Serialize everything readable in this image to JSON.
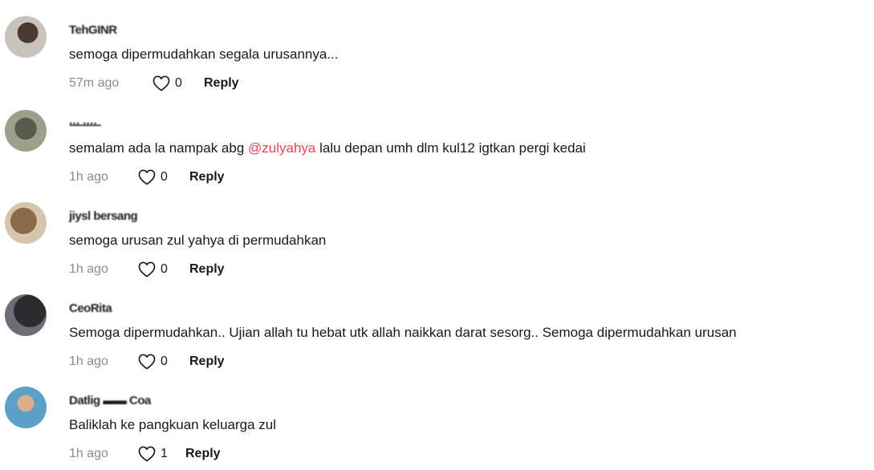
{
  "comments": [
    {
      "username": "TehGINR",
      "text_before": "semoga dipermudahkan segala urusannya...",
      "mention": "",
      "text_after": "",
      "time": "57m ago",
      "likes": "0",
      "reply_label": "Reply"
    },
    {
      "username": "·̶·̶·̶ ·̶·̶·̶·̶",
      "text_before": "semalam ada la nampak abg ",
      "mention": "@zulyahya",
      "text_after": " lalu depan umh dlm kul12 igtkan pergi kedai",
      "time": "1h ago",
      "likes": "0",
      "reply_label": "Reply"
    },
    {
      "username": "jiysl  bersang",
      "text_before": "semoga urusan zul yahya di permudahkan",
      "mention": "",
      "text_after": "",
      "time": "1h ago",
      "likes": "0",
      "reply_label": "Reply"
    },
    {
      "username": "CeoRita",
      "text_before": "Semoga dipermudahkan.. Ujian allah tu hebat utk allah naikkan darat sesorg.. Semoga dipermudahkan urusan",
      "mention": "",
      "text_after": "",
      "time": "1h ago",
      "likes": "0",
      "reply_label": "Reply"
    },
    {
      "username": "Datlig ▬▬ Coa",
      "text_before": "Baliklah ke pangkuan keluarga zul",
      "mention": "",
      "text_after": "",
      "time": "1h ago",
      "likes": "1",
      "reply_label": "Reply"
    }
  ],
  "icons": {
    "like": "heart-outline-icon",
    "avatar": "user-avatar"
  },
  "colors": {
    "mention": "#e9445a",
    "meta_text": "#8a8b91",
    "primary_text": "#161823"
  }
}
